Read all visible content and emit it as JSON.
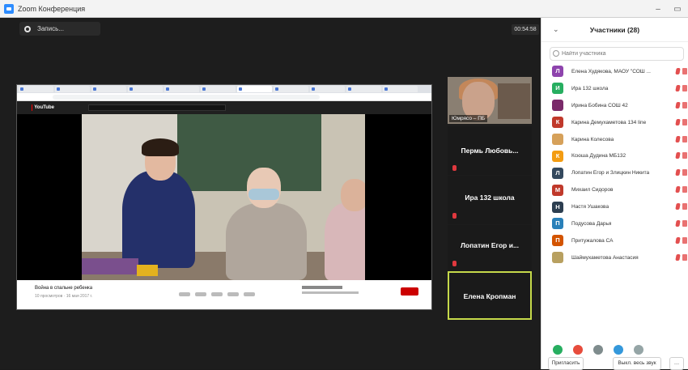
{
  "window": {
    "title": "Zoom Конференция",
    "controls": [
      "–",
      "▭"
    ]
  },
  "toolbar": {
    "record_label": "Запись...",
    "timer": "00:54:58"
  },
  "shared_screen": {
    "browser_tab_count": 11,
    "youtube_logo": "YouTube",
    "video_title": "Война в спальне ребенка",
    "video_meta": "10 просмотров · 16 мая 2017 г."
  },
  "tiles": [
    {
      "name": "Юмрясо – ПБ",
      "has_video": true
    },
    {
      "name": "Пермь Любовь...",
      "muted": true
    },
    {
      "name": "Ира 132 школа",
      "muted": true
    },
    {
      "name": "Лопатин Егор и...",
      "muted": true
    },
    {
      "name": "Елена Кропман",
      "active_speaker": true
    }
  ],
  "participants": {
    "title": "Участники (28)",
    "search_placeholder": "Найти участника",
    "items": [
      {
        "initial": "Л",
        "name": "Елена Худякова, МАОУ \"СОШ ...",
        "color": "#8e44ad"
      },
      {
        "initial": "И",
        "name": "Ира 132 школа",
        "color": "#27ae60"
      },
      {
        "initial": "",
        "name": "Ирина Бобина СОШ 42",
        "color": "#7a2a6a"
      },
      {
        "initial": "К",
        "name": "Карина Демухаметова 134 line",
        "color": "#c0392b"
      },
      {
        "initial": "",
        "name": "Карина Колесова",
        "color": "#d6a15a"
      },
      {
        "initial": "К",
        "name": "Ксюша Дудина МБ132",
        "color": "#f39c12"
      },
      {
        "initial": "Л",
        "name": "Лопатин Егор и Злицкин Никита",
        "color": "#34495e"
      },
      {
        "initial": "М",
        "name": "Михаил Сидоров",
        "color": "#c0392b"
      },
      {
        "initial": "Н",
        "name": "Настя Ушакова",
        "color": "#2c3e50"
      },
      {
        "initial": "П",
        "name": "Подусова Дарья",
        "color": "#2980b9"
      },
      {
        "initial": "П",
        "name": "Притужалова СА",
        "color": "#d35400"
      },
      {
        "initial": "",
        "name": "Шаймухаметова Анастасия",
        "color": "#b8a060"
      }
    ],
    "reactions": [
      {
        "icon": "yes-icon",
        "color": "#27ae60"
      },
      {
        "icon": "no-icon",
        "color": "#e74c3c"
      },
      {
        "icon": "slower-icon",
        "color": "#7f8c8d"
      },
      {
        "icon": "faster-icon",
        "color": "#3498db"
      },
      {
        "icon": "more-icon",
        "color": "#95a5a6"
      }
    ],
    "invite_label": "Пригласить",
    "mute_all_label": "Выкл. весь звук"
  }
}
